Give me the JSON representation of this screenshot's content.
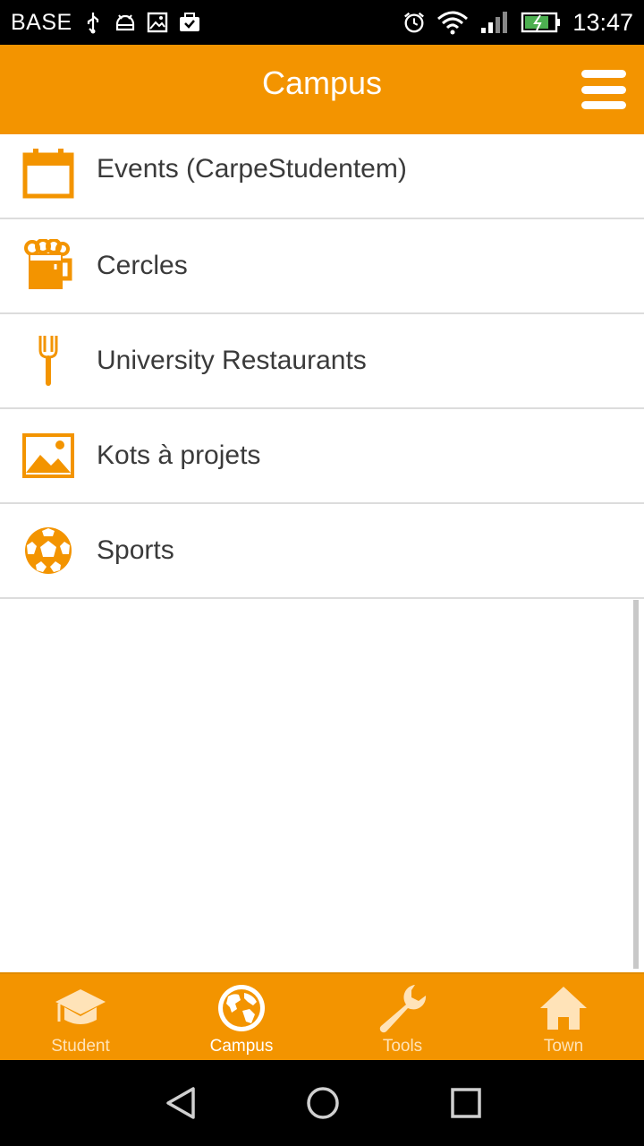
{
  "status_bar": {
    "carrier": "BASE",
    "time": "13:47"
  },
  "app_bar": {
    "title": "Campus"
  },
  "list": {
    "items": [
      {
        "label": "Events (CarpeStudentem)",
        "icon": "calendar-icon"
      },
      {
        "label": "Cercles",
        "icon": "beer-mug-icon"
      },
      {
        "label": "University Restaurants",
        "icon": "fork-icon"
      },
      {
        "label": "Kots à projets",
        "icon": "image-icon"
      },
      {
        "label": "Sports",
        "icon": "soccer-ball-icon"
      }
    ]
  },
  "bottom_nav": {
    "tabs": [
      {
        "label": "Student",
        "icon": "graduation-cap-icon",
        "active": false
      },
      {
        "label": "Campus",
        "icon": "globe-icon",
        "active": true
      },
      {
        "label": "Tools",
        "icon": "wrench-icon",
        "active": false
      },
      {
        "label": "Town",
        "icon": "home-icon",
        "active": false
      }
    ]
  },
  "colors": {
    "accent": "#f39400",
    "text": "#3a3a3a",
    "divider": "#dcdcdc"
  }
}
